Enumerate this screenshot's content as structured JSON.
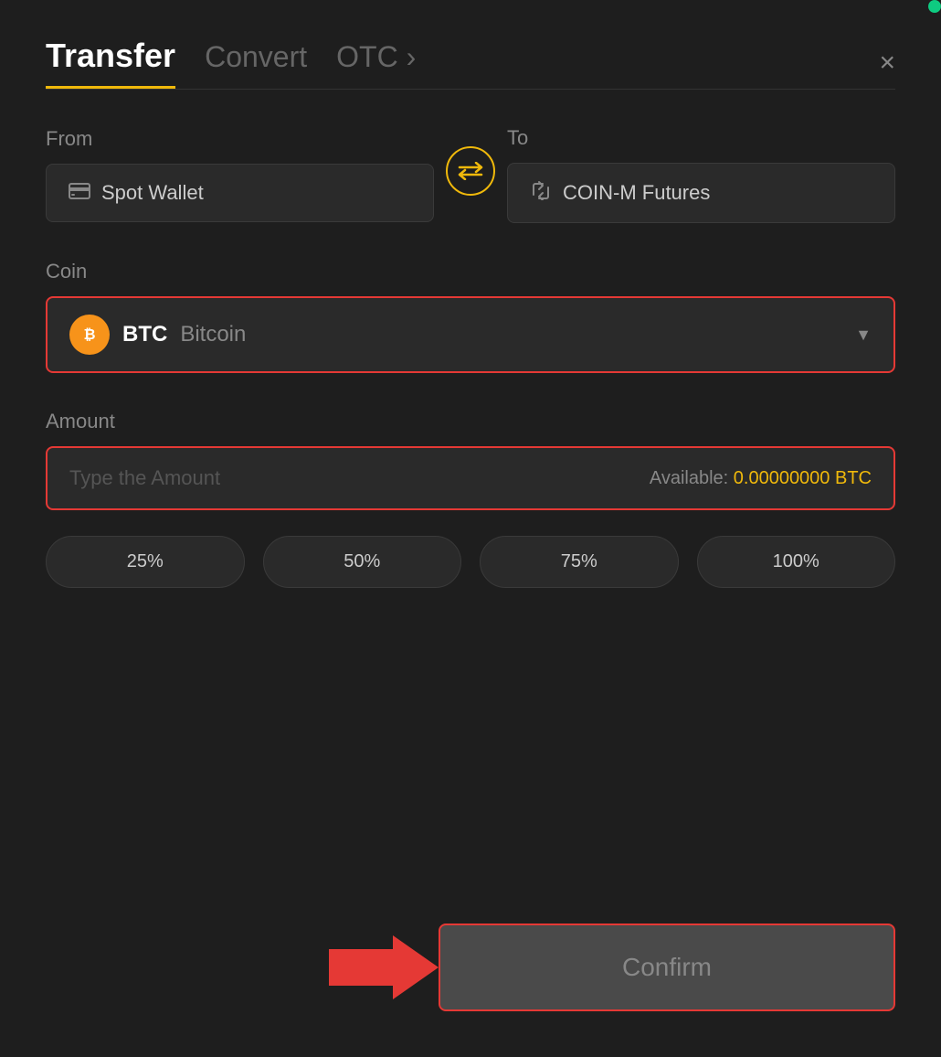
{
  "header": {
    "active_tab": "Transfer",
    "tabs": [
      {
        "id": "transfer",
        "label": "Transfer",
        "active": true
      },
      {
        "id": "convert",
        "label": "Convert",
        "active": false
      },
      {
        "id": "otc",
        "label": "OTC ›",
        "active": false
      }
    ],
    "close_label": "×"
  },
  "from_section": {
    "label": "From",
    "wallet_label": "Spot Wallet",
    "wallet_icon": "card"
  },
  "to_section": {
    "label": "To",
    "wallet_label": "COIN-M Futures",
    "wallet_icon": "transfer"
  },
  "swap_button": {
    "icon": "⇄"
  },
  "coin_section": {
    "label": "Coin",
    "coin_symbol": "BTC",
    "coin_name": "Bitcoin",
    "icon_text": "₿"
  },
  "amount_section": {
    "label": "Amount",
    "placeholder": "Type the Amount",
    "available_label": "Available:",
    "available_amount": "0.00000000 BTC"
  },
  "percent_buttons": [
    {
      "label": "25%",
      "value": 25
    },
    {
      "label": "50%",
      "value": 50
    },
    {
      "label": "75%",
      "value": 75
    },
    {
      "label": "100%",
      "value": 100
    }
  ],
  "confirm_button": {
    "label": "Confirm"
  },
  "colors": {
    "accent_yellow": "#f0b90b",
    "accent_red": "#e53935",
    "bg_dark": "#1e1e1e",
    "bg_card": "#2a2a2a",
    "text_muted": "#888"
  }
}
